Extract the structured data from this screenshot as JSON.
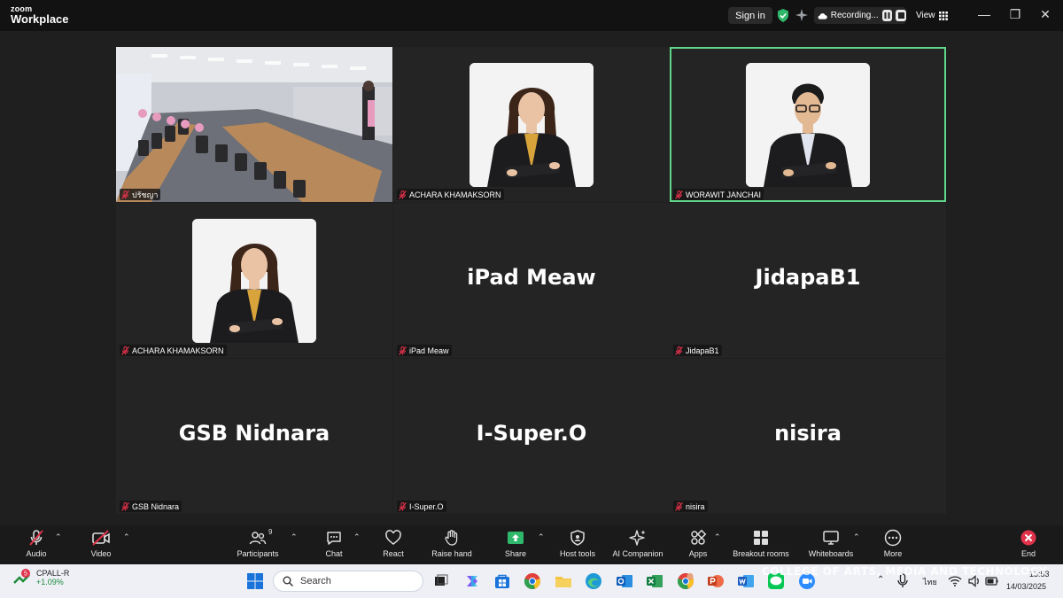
{
  "titlebar": {
    "logo_top": "zoom",
    "logo_bottom": "Workplace",
    "sign_in": "Sign in",
    "recording": "Recording...",
    "view": "View"
  },
  "tiles": [
    {
      "name": "ปรัชญา",
      "display": "",
      "video": "room",
      "active": false
    },
    {
      "name": "ACHARA KHAMAKSORN",
      "display": "",
      "video": "woman",
      "active": false
    },
    {
      "name": "WORAWIT JANCHAI",
      "display": "",
      "video": "man",
      "active": true
    },
    {
      "name": "ACHARA KHAMAKSORN",
      "display": "",
      "video": "woman",
      "active": false
    },
    {
      "name": "iPad Meaw",
      "display": "iPad Meaw",
      "video": "none",
      "active": false
    },
    {
      "name": "JidapaB1",
      "display": "JidapaB1",
      "video": "none",
      "active": false
    },
    {
      "name": "GSB Nidnara",
      "display": "GSB Nidnara",
      "video": "none",
      "active": false
    },
    {
      "name": "I-Super.O",
      "display": "I-Super.O",
      "video": "none",
      "active": false
    },
    {
      "name": "nisira",
      "display": "nisira",
      "video": "none",
      "active": false
    }
  ],
  "toolbar": {
    "audio": "Audio",
    "video": "Video",
    "participants": "Participants",
    "participants_count": "9",
    "chat": "Chat",
    "react": "React",
    "raise_hand": "Raise hand",
    "share": "Share",
    "host_tools": "Host tools",
    "ai_companion": "AI Companion",
    "apps": "Apps",
    "breakout_rooms": "Breakout rooms",
    "whiteboards": "Whiteboards",
    "more": "More",
    "end": "End"
  },
  "taskbar": {
    "stock_name": "CPALL-R",
    "stock_change": "+1.09%",
    "stock_badge": "5",
    "search": "Search",
    "lang": "ไทย",
    "time": "13:53",
    "date": "14/03/2025"
  },
  "watermark": "COLLEGE OF ARTS, MEDIA AND TECHNOLOGY",
  "colors": {
    "active_border": "#5fd68a",
    "end_red": "#e0324b",
    "share_green": "#2fb86b"
  }
}
